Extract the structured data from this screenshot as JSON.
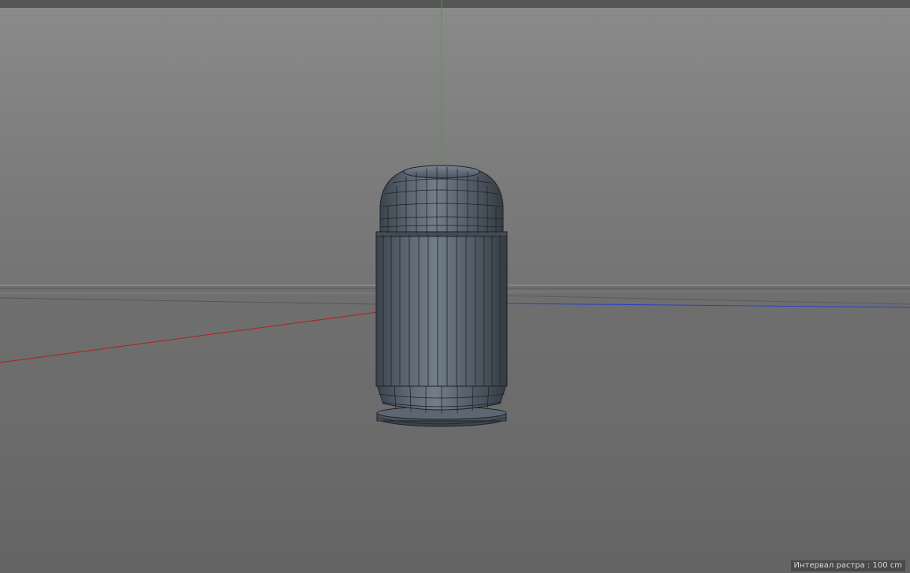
{
  "viewport": {
    "grid_interval_label": "Интервал растра",
    "grid_interval_value": "100 cm"
  },
  "colors": {
    "background_upper": "#8a8a8a",
    "background_lower": "#6b6b6b",
    "axis_x": "#b02020",
    "axis_y": "#3aa63a",
    "axis_z": "#2a3fc4",
    "mesh_fill": "#4d5661",
    "mesh_wire": "#1e2329"
  },
  "icons": [
    "bullet-mesh-object"
  ]
}
